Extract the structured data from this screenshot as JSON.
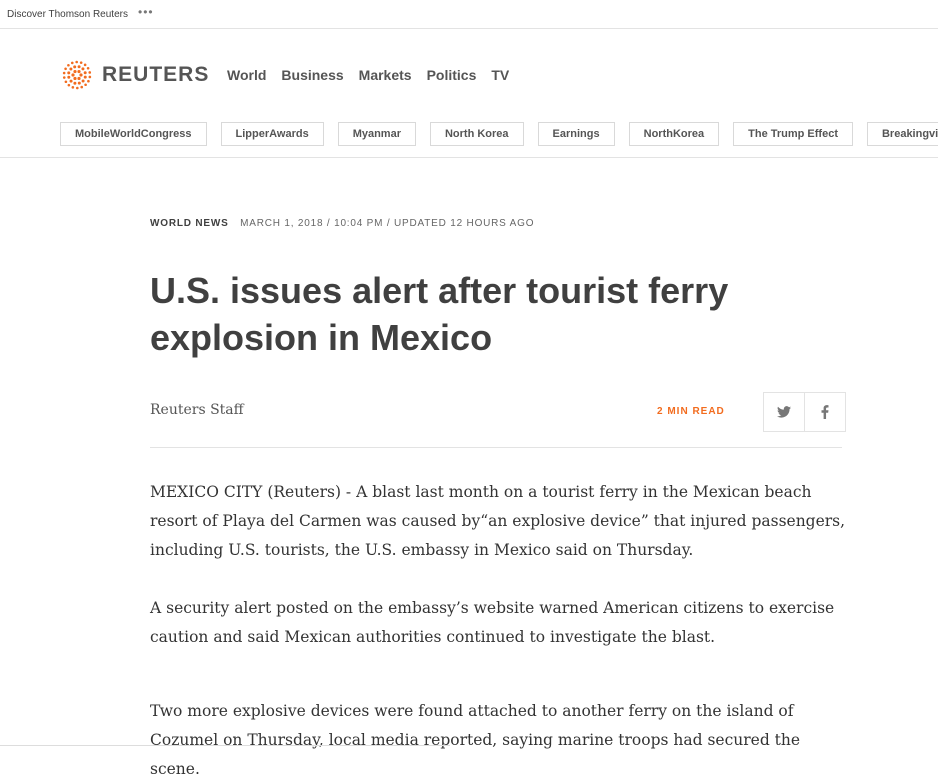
{
  "utility_bar": {
    "discover": "Discover Thomson Reuters",
    "more": "•••"
  },
  "header": {
    "brand": "REUTERS",
    "nav": [
      "World",
      "Business",
      "Markets",
      "Politics",
      "TV"
    ]
  },
  "trending": [
    "MobileWorldCongress",
    "LipperAwards",
    "Myanmar",
    "North Korea",
    "Earnings",
    "NorthKorea",
    "The Trump Effect",
    "Breakingviews"
  ],
  "article": {
    "section": "World News",
    "date": "March 1, 2018 / 10:04 PM / Updated 12 hours ago",
    "headline": "U.S. issues alert after tourist ferry explosion in Mexico",
    "byline": "Reuters Staff",
    "read_time": "2 MIN READ",
    "paragraphs": [
      "MEXICO CITY (Reuters) - A blast last month on a tourist ferry in the Mexican beach resort of Playa del Carmen was caused by“an explosive device” that injured passengers, including U.S. tourists, the U.S. embassy in Mexico said on Thursday.",
      "A security alert posted on the embassy’s website warned American citizens to exercise caution and said Mexican authorities continued to investigate the blast.",
      "Two more explosive devices were found attached to another ferry on the island of Cozumel on Thursday, local media reported, saying marine troops had secured the scene."
    ]
  },
  "colors": {
    "accent": "#f26c1f",
    "text": "#404040",
    "rule": "#e3e3e3"
  },
  "icons": {
    "logo": "reuters-dot-logo-icon",
    "twitter": "twitter-icon",
    "facebook": "facebook-icon"
  }
}
